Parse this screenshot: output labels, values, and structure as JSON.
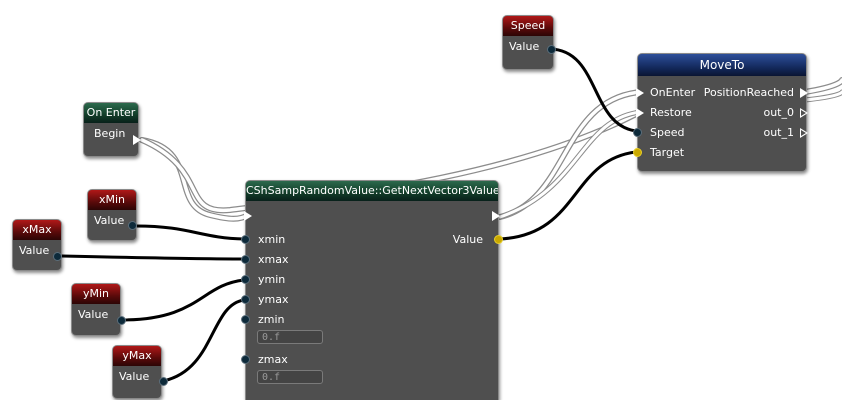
{
  "colors": {
    "node_bg": "#4f4f4f",
    "variable_header": "#8a1212",
    "event_header": "#1e5a3c",
    "function_header": "#1a2f66",
    "exec_wire": "#ffffff",
    "data_wire": "#000000",
    "vector_pin": "#c9a800"
  },
  "nodes": {
    "speed": {
      "title": "Speed",
      "pin": "Value"
    },
    "on_enter": {
      "title": "On Enter",
      "pin": "Begin"
    },
    "xmin": {
      "title": "xMin",
      "pin": "Value"
    },
    "xmax": {
      "title": "xMax",
      "pin": "Value"
    },
    "ymin": {
      "title": "yMin",
      "pin": "Value"
    },
    "ymax": {
      "title": "yMax",
      "pin": "Value"
    },
    "random": {
      "title": "CShSampRandomValue::GetNextVector3Value",
      "inputs": [
        "xmin",
        "xmax",
        "ymin",
        "ymax",
        "zmin",
        "zmax"
      ],
      "zmin_value": "0.f",
      "zmax_value": "0.f",
      "output": "Value"
    },
    "moveto": {
      "title": "MoveTo",
      "inputs": [
        "OnEnter",
        "Restore",
        "Speed",
        "Target"
      ],
      "outputs": [
        "PositionReached",
        "out_0",
        "out_1"
      ]
    }
  }
}
